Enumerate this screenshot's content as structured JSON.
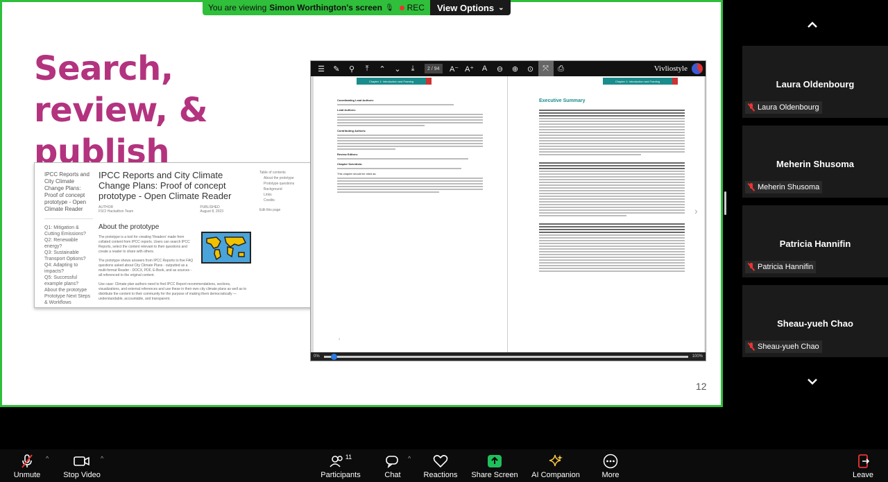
{
  "banner": {
    "prefix": "You are viewing",
    "presenter": "Simon Worthington's screen",
    "rec": "REC",
    "view_options": "View Options"
  },
  "slide": {
    "title": "Search, review, & publish",
    "page_number": "12",
    "web_screenshot": {
      "sidebar_title": "IPCC Reports and City Climate Change Plans: Proof of concept prototype - Open Climate Reader",
      "sidebar_links": [
        "Q1: Mitigation & Cutting Emissions?",
        "Q2: Renewable energy?",
        "Q3: Sustainable Transport Options?",
        "Q4: Adapting to impacts?",
        "Q5: Successful example plans?",
        "About the prototype",
        "Prototype Next Steps & Workflows"
      ],
      "heading": "IPCC Reports and City Climate Change Plans: Proof of concept prototype - Open Climate Reader",
      "author_label": "AUTHOR",
      "author": "FSCI Hackathon Team",
      "published_label": "PUBLISHED",
      "published": "August 8, 2023",
      "about_heading": "About the prototype",
      "para1": "The prototype is a tool for creating 'Readers' made from collated content from IPCC reports. Users can search IPCC Reports, select the content relevant to their questions and create a reader to share with others.",
      "para2": "The prototype shows answers from IPCC Reports to five FAQ questions asked about City Climate Plans - outputted as a multi-format Reader - DOCX, PDF, E-Book, and as sources - all referenced to the original content.",
      "para3": "Use case: Climate plan authors need to find IPCC Report recommendations, sections, visualizations, and external references and use these in their own city climate plans as well as to distribute the content to their community for the purpose of making them democratically — understandable, accountable, and transparent.",
      "toc_title": "Table of contents",
      "toc_items": [
        "About the prototype",
        "Prototype questions",
        "Background",
        "Links",
        "Credits"
      ],
      "edit_link": "Edit this page"
    },
    "viewer": {
      "page_indicator": "2 / 94",
      "brand": "Vivliostyle",
      "progress_start": "0%",
      "progress_end": "100%",
      "progress_value": 0.02,
      "left_page": {
        "tab": "Chapter 1: Introduction and Framing",
        "sections": [
          "Coordinating Lead Authors:",
          "Lead Authors:",
          "Contributing Authors:",
          "Review Editors:",
          "Chapter Scientists:"
        ],
        "cite_label": "This chapter should be cited as:"
      },
      "right_page": {
        "tab": "Chapter 1: Introduction and Framing",
        "title": "Executive Summary"
      }
    }
  },
  "participants": [
    {
      "name": "Laura Oldenbourg",
      "label": "Laura Oldenbourg"
    },
    {
      "name": "Meherin Shusoma",
      "label": "Meherin Shusoma"
    },
    {
      "name": "Patricia Hannifin",
      "label": "Patricia Hannifin"
    },
    {
      "name": "Sheau-yueh Chao",
      "label": "Sheau-yueh Chao"
    }
  ],
  "toolbar": {
    "unmute": "Unmute",
    "stop_video": "Stop Video",
    "participants": "Participants",
    "participants_count": "11",
    "chat": "Chat",
    "reactions": "Reactions",
    "share_screen": "Share Screen",
    "ai_companion": "AI Companion",
    "more": "More",
    "leave": "Leave"
  },
  "colors": {
    "share_border": "#2fbf3a",
    "title": "#b3337f",
    "share_button": "#1fbf5b",
    "muted": "#e33333"
  }
}
